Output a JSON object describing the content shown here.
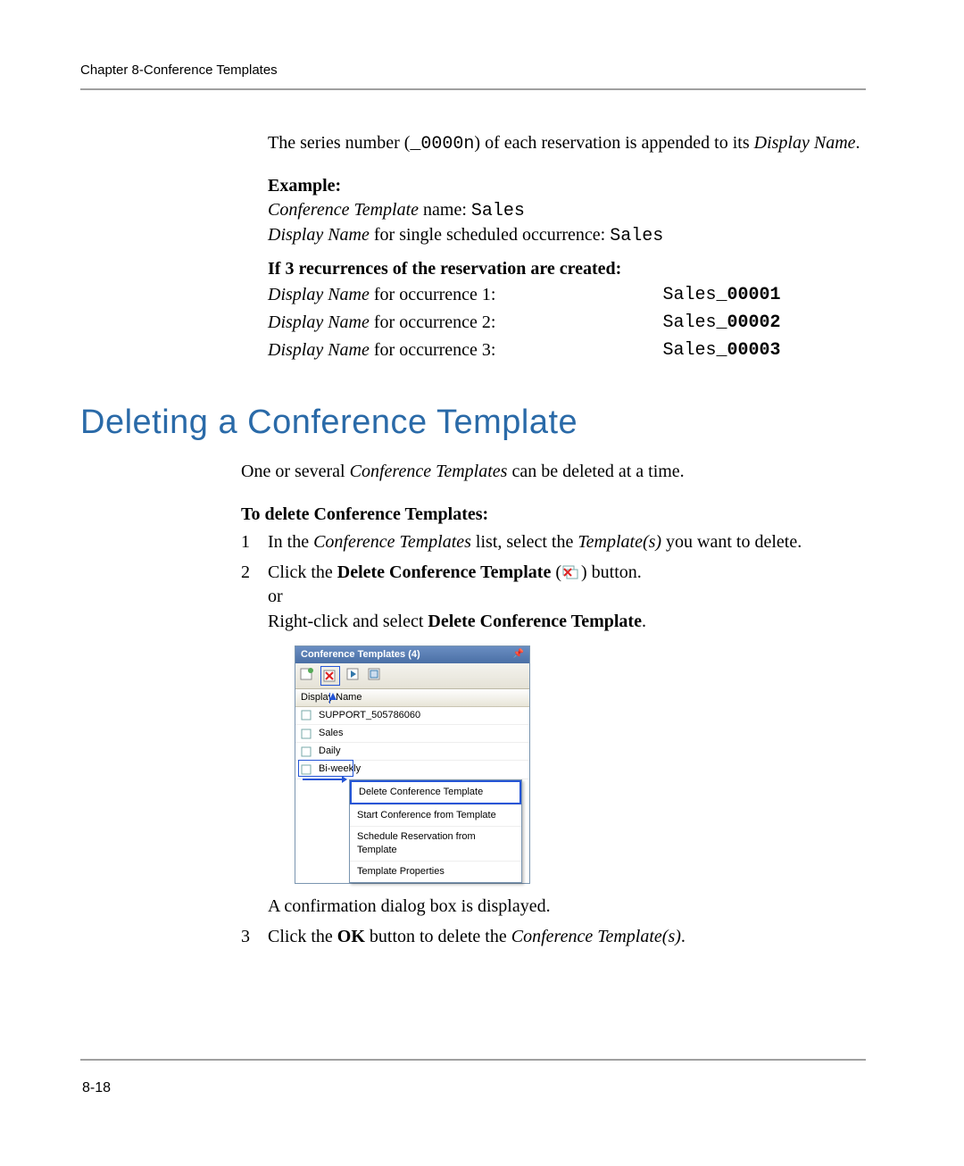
{
  "header": {
    "text": "Chapter 8-Conference Templates"
  },
  "page_number": "8-18",
  "intro": {
    "part1": "The series number (",
    "code": "_0000n",
    "part2": ") of each reservation is appended to its ",
    "emph": "Display Name",
    "tail": "."
  },
  "example_label": "Example:",
  "example_line1": {
    "emph": "Conference Template",
    "mid": " name: ",
    "code": "Sales"
  },
  "example_line2": {
    "emph": "Display Name",
    "mid": " for single scheduled occurrence: ",
    "code": "Sales"
  },
  "recurrence_heading": "If 3 recurrences of the reservation are created:",
  "occurrences": [
    {
      "label_emph": "Display Name",
      "label_rest": " for occurrence 1:",
      "value_pre": "Sales",
      "value_bold": "_00001"
    },
    {
      "label_emph": "Display Name",
      "label_rest": " for occurrence 2:",
      "value_pre": "Sales",
      "value_bold": "_00002"
    },
    {
      "label_emph": "Display Name",
      "label_rest": " for occurrence 3:",
      "value_pre": "Sales",
      "value_bold": "_00003"
    }
  ],
  "section_title": "Deleting a Conference Template",
  "section_intro": {
    "pre": "One or several ",
    "emph": "Conference Templates",
    "post": " can be deleted at a time."
  },
  "procedure_heading": "To delete Conference Templates:",
  "steps": {
    "s1": {
      "num": "1",
      "a": "In the ",
      "b": "Conference Templates",
      "c": " list, select the ",
      "d": "Template(s)",
      "e": " you want to delete."
    },
    "s2": {
      "num": "2",
      "a": "Click the ",
      "b": "Delete Conference Template",
      "c": " (",
      "d": ") button.",
      "or": "or",
      "e": "Right-click and select ",
      "f": "Delete Conference Template",
      "g": "."
    },
    "s2_after": "A confirmation dialog box is displayed.",
    "s3": {
      "num": "3",
      "a": "Click the ",
      "b": "OK",
      "c": " button to delete the ",
      "d": "Conference Template(s)",
      "e": "."
    }
  },
  "ui": {
    "title": "Conference Templates (4)",
    "column": "Display Name",
    "rows": [
      "SUPPORT_505786060",
      "Sales",
      "Daily",
      "Bi-weekly"
    ],
    "context_menu": [
      "Delete Conference Template",
      "Start Conference from Template",
      "Schedule Reservation from Template",
      "Template Properties"
    ]
  },
  "icons": {
    "delete_template": "delete-conference-template-icon"
  }
}
